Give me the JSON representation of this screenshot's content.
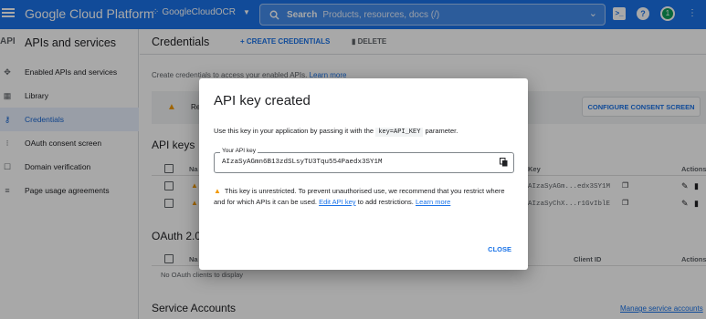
{
  "topbar": {
    "brand": "Google Cloud Platform",
    "project": "GoogleCloudOCR",
    "search_label": "Search",
    "search_placeholder": "Products, resources, docs (/)",
    "avatar_letter": "1",
    "color": "#1a73e8"
  },
  "sidebar": {
    "logo": "API",
    "title": "APIs and services",
    "items": [
      {
        "label": "Enabled APIs and services",
        "icon": "diamond-grid-icon"
      },
      {
        "label": "Library",
        "icon": "library-grid-icon"
      },
      {
        "label": "Credentials",
        "icon": "key-icon",
        "active": true
      },
      {
        "label": "OAuth consent screen",
        "icon": "consent-icon"
      },
      {
        "label": "Domain verification",
        "icon": "domain-icon"
      },
      {
        "label": "Page usage agreements",
        "icon": "agreements-icon"
      }
    ]
  },
  "main": {
    "title": "Credentials",
    "create_label": "CREATE CREDENTIALS",
    "delete_label": "DELETE",
    "intro_text": "Create credentials to access your enabled APIs.",
    "intro_link": "Learn more",
    "banner_prefix": "Re",
    "consent_button": "CONFIGURE CONSENT SCREEN",
    "api_keys_title": "API keys",
    "col_name": "Na",
    "col_key": "Key",
    "col_actions": "Actions",
    "rows": [
      {
        "key": "AIzaSyAGm...edx3SY1M"
      },
      {
        "key": "AIzaSyChX...r1GvIblE"
      }
    ],
    "oauth_title": "OAuth 2.0",
    "oauth_col_name": "Na",
    "oauth_col_client": "Client ID",
    "oauth_col_actions": "Actions",
    "oauth_empty": "No OAuth clients to display",
    "service_title": "Service Accounts",
    "manage_link": "Manage service accounts"
  },
  "dialog": {
    "title": "API key created",
    "desc_before": "Use this key in your application by passing it with the",
    "desc_code": "key=API_KEY",
    "desc_after": "parameter.",
    "field_label": "Your API key",
    "api_key": "AIzaSyAGmn6B13zdSLsyTU3Tqu554Paedx3SY1M",
    "warning_text": "This key is unrestricted. To prevent unauthorised use, we recommend that you restrict where and for which APIs it can be used.",
    "edit_link": "Edit API key",
    "warning_after": "to add restrictions.",
    "learn_more": "Learn more",
    "close_label": "CLOSE"
  }
}
